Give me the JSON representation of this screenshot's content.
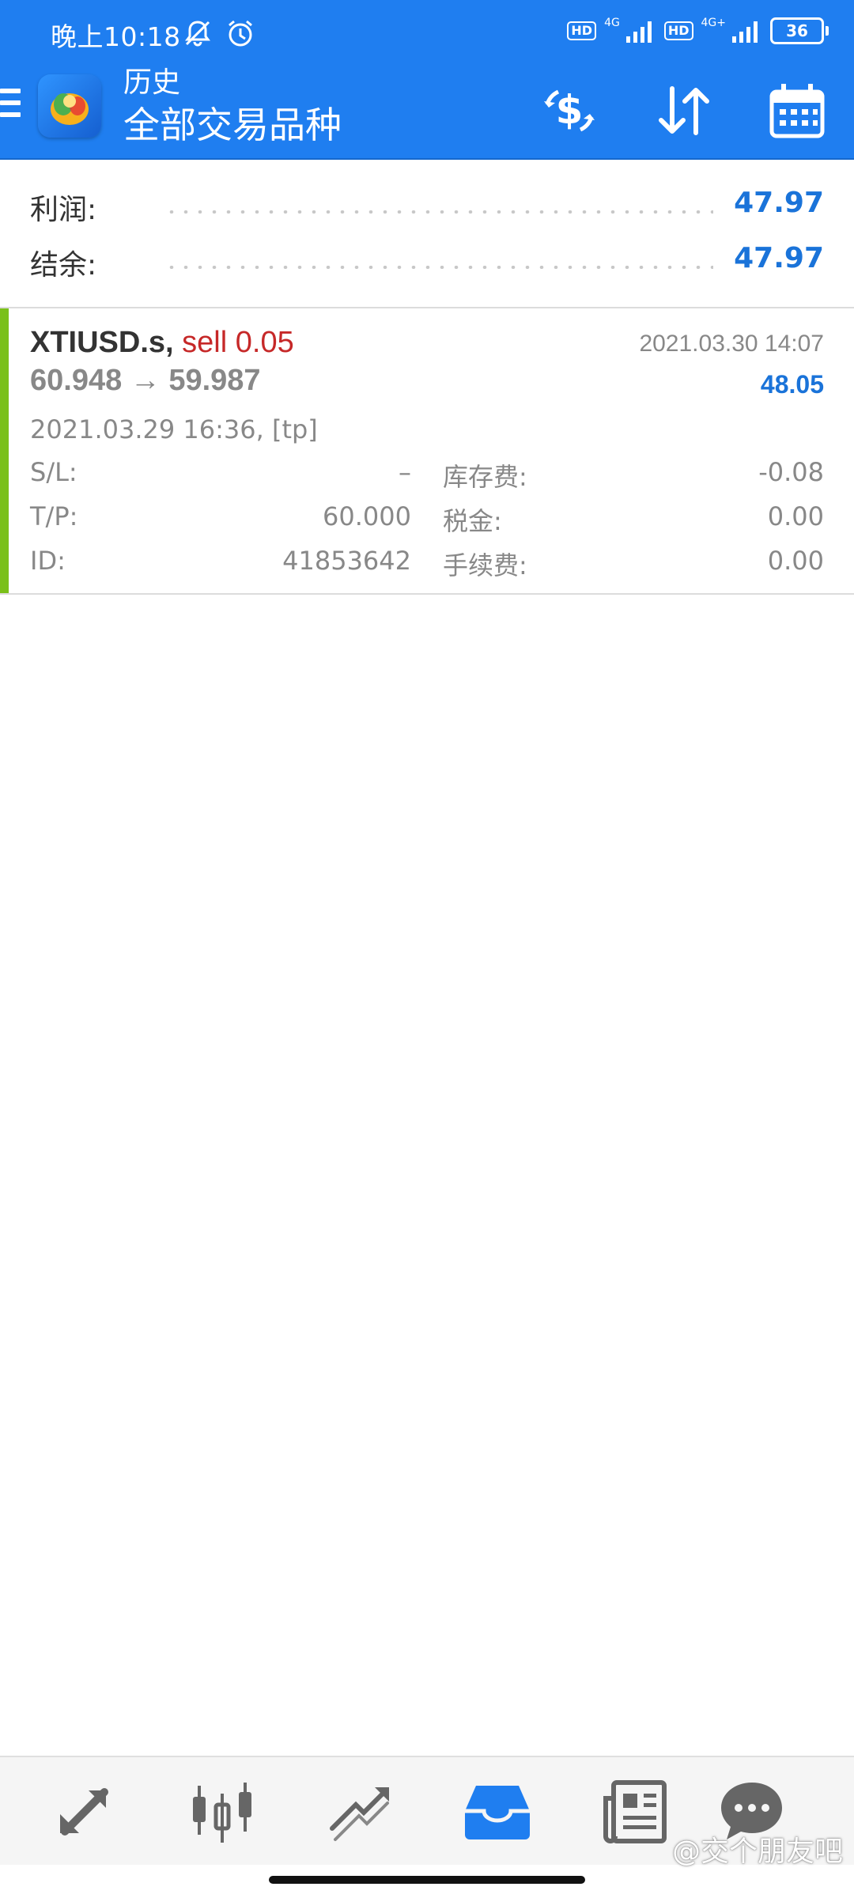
{
  "status_bar": {
    "time": "晚上10:18",
    "left_icons": [
      "bell-off-icon",
      "alarm-icon"
    ],
    "network": [
      "HD",
      "4G",
      "HD",
      "4G+"
    ],
    "battery": "36"
  },
  "header": {
    "subtitle": "历史",
    "title": "全部交易品种",
    "actions": [
      "currency-exchange-icon",
      "sort-icon",
      "calendar-icon"
    ]
  },
  "summary": {
    "profit_label": "利润:",
    "profit_value": "47.97",
    "balance_label": "结余:",
    "balance_value": "47.97"
  },
  "deal": {
    "symbol": "XTIUSD.s,",
    "type": "sell 0.05",
    "close_time": "2021.03.30 14:07",
    "prices": "60.948 → 59.987",
    "profit": "48.05",
    "open_time": "2021.03.29 16:36, [tp]",
    "sl_label": "S/L:",
    "sl_value": "–",
    "tp_label": "T/P:",
    "tp_value": "60.000",
    "id_label": "ID:",
    "id_value": "41853642",
    "swap_label": "库存费:",
    "swap_value": "-0.08",
    "tax_label": "税金:",
    "tax_value": "0.00",
    "commission_label": "手续费:",
    "commission_value": "0.00",
    "indicator_color": "#7ac019"
  },
  "bottom_nav": {
    "items": [
      "quotes-icon",
      "chart-icon",
      "trade-icon",
      "history-icon",
      "news-icon",
      "chat-icon"
    ],
    "active": "history-icon",
    "active_color": "#1f7ef0"
  },
  "watermark": "@交个朋友吧",
  "colors": {
    "header_bg": "#1f7ef0",
    "profit_blue": "#1a73d9",
    "sell_red": "#c62828"
  }
}
